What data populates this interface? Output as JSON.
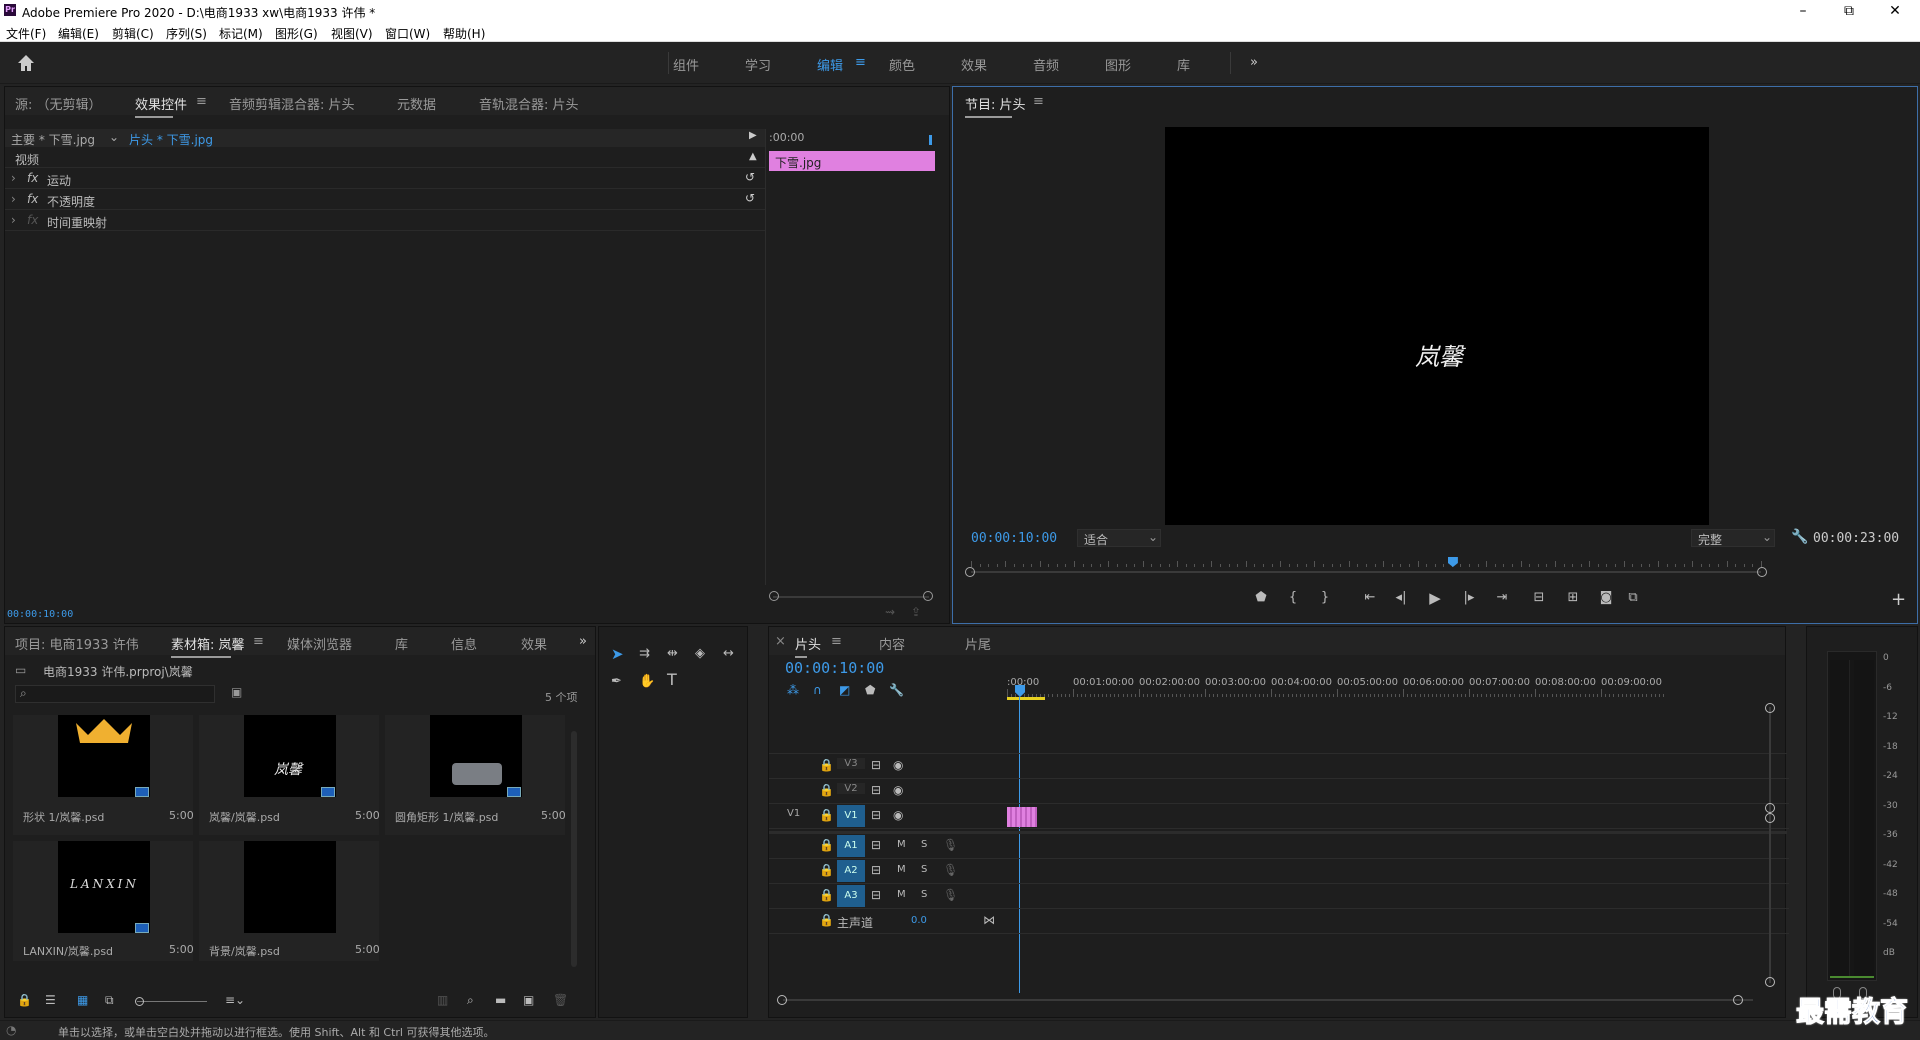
{
  "window": {
    "app_icon": "Pr",
    "title": "Adobe Premiere Pro 2020 - D:\\电商1933 xw\\电商1933 许伟 *",
    "min": "–",
    "max": "⧉",
    "close": "✕"
  },
  "menu": [
    "文件(F)",
    "编辑(E)",
    "剪辑(C)",
    "序列(S)",
    "标记(M)",
    "图形(G)",
    "视图(V)",
    "窗口(W)",
    "帮助(H)"
  ],
  "workspaces": {
    "items": [
      "组件",
      "学习",
      "编辑",
      "颜色",
      "效果",
      "音频",
      "图形",
      "库"
    ],
    "active": "编辑",
    "more": "»"
  },
  "effect_controls": {
    "tabs": [
      "源: （无剪辑）",
      "效果控件",
      "音频剪辑混合器: 片头",
      "元数据",
      "音轨混合器: 片头"
    ],
    "active_tab": "效果控件",
    "master_clip": "主要 * 下雪.jpg",
    "clip_link": "片头 * 下雪.jpg",
    "section_video": "视频",
    "effects": [
      "运动",
      "不透明度",
      "时间重映射"
    ],
    "fx_label": "fx",
    "mini_timecode": ":00:00",
    "mini_clip_name": "下雪.jpg",
    "timecode": "00:00:10:00"
  },
  "program_monitor": {
    "title": "节目: 片头",
    "overlay_text": "岚馨",
    "current_time": "00:00:10:00",
    "zoom": "适合",
    "quality": "完整",
    "duration": "00:00:23:00",
    "playhead_fraction": 0.61
  },
  "project_panel": {
    "tabs": [
      "项目: 电商1933 许伟",
      "素材箱: 岚馨",
      "媒体浏览器",
      "库",
      "信息",
      "效果"
    ],
    "active_tab": "素材箱: 岚馨",
    "path": "电商1933 许伟.prproj\\岚馨",
    "search_placeholder": "",
    "item_count": "5 个项",
    "items": [
      {
        "name": "形状 1/岚馨.psd",
        "duration": "5:00",
        "kind": "crown"
      },
      {
        "name": "岚馨/岚馨.psd",
        "duration": "5:00",
        "kind": "text",
        "thumb_text": "岚馨"
      },
      {
        "name": "圆角矩形 1/岚馨.psd",
        "duration": "5:00",
        "kind": "rect"
      },
      {
        "name": "LANXIN/岚馨.psd",
        "duration": "5:00",
        "kind": "text",
        "thumb_text": "LANXIN"
      },
      {
        "name": "背景/岚馨.psd",
        "duration": "5:00",
        "kind": "blank"
      }
    ]
  },
  "timeline": {
    "tabs": [
      "片头",
      "内容",
      "片尾"
    ],
    "active_tab": "片头",
    "timecode": "00:00:10:00",
    "ruler": [
      ":00:00",
      "00:01:00:00",
      "00:02:00:00",
      "00:03:00:00",
      "00:04:00:00",
      "00:05:00:00",
      "00:06:00:00",
      "00:07:00:00",
      "00:08:00:00",
      "00:09:00:00"
    ],
    "video_tracks": [
      "V3",
      "V2",
      "V1"
    ],
    "audio_tracks": [
      "A1",
      "A2",
      "A3"
    ],
    "source_patch": "V1",
    "master_label": "主声道",
    "master_value": "0.0",
    "mute_label": "M",
    "solo_label": "S"
  },
  "audio_meter": {
    "scale": [
      "0",
      "-6",
      "-12",
      "-18",
      "-24",
      "-30",
      "-36",
      "-42",
      "-48",
      "-54",
      "dB"
    ]
  },
  "status_bar": {
    "text": "单击以选择，或单击空白处并拖动以进行框选。使用 Shift、Alt 和 Ctrl 可获得其他选项。"
  },
  "watermark": "最需教育",
  "colors": {
    "accent": "#3d9ae8",
    "clip_pink": "#e080e0",
    "track_blue": "#1f5f8f",
    "panel_bg": "#1e1e1e"
  }
}
